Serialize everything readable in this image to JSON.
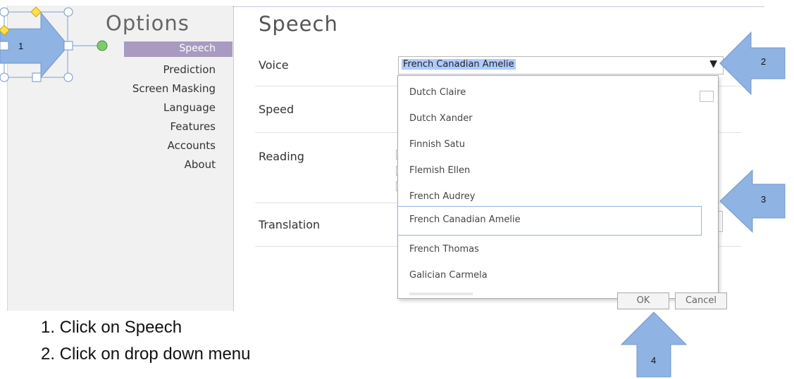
{
  "sidebar": {
    "title": "Options",
    "items": [
      {
        "label": "Speech"
      },
      {
        "label": "Prediction"
      },
      {
        "label": "Screen Masking"
      },
      {
        "label": "Language"
      },
      {
        "label": "Features"
      },
      {
        "label": "Accounts"
      },
      {
        "label": "About"
      }
    ]
  },
  "main": {
    "heading": "Speech",
    "rows": {
      "voice": "Voice",
      "speed": "Speed",
      "reading": "Reading",
      "translation": "Translation"
    },
    "voice_select": {
      "value": "French Canadian Amelie",
      "caret": "▼"
    },
    "dropdown_options": [
      "Dutch Claire",
      "Dutch Xander",
      "Finnish Satu",
      "Flemish Ellen",
      "French Audrey",
      "French Canadian Amelie",
      "French Thomas",
      "Galician Carmela"
    ],
    "buttons": {
      "ok": "OK",
      "cancel": "Cancel"
    }
  },
  "instructions": [
    "1.  Click on Speech",
    "2.  Click on drop down menu"
  ],
  "callouts": [
    "1",
    "2",
    "3",
    "4"
  ],
  "colors": {
    "selected_nav": "#a99bbf",
    "arrow_fill": "#8fb3e2",
    "select_highlight": "#aecbff",
    "shape_handle": "#ffe04a"
  }
}
